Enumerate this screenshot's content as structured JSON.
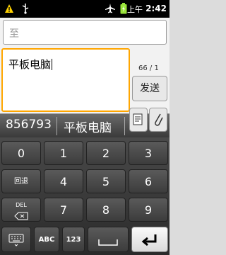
{
  "status_bar": {
    "ampm": "上午",
    "time": "2:42"
  },
  "compose": {
    "to_placeholder": "至",
    "message_text": "平板电脑",
    "counter": "66 / 1",
    "send_label": "发送"
  },
  "candidates": [
    "856793",
    "平板电脑"
  ],
  "keyboard": {
    "keys_row1": [
      "0",
      "1",
      "2",
      "3"
    ],
    "back_label": "回退",
    "keys_row2": [
      "4",
      "5",
      "6"
    ],
    "del_label": "DEL",
    "keys_row3": [
      "7",
      "8",
      "9"
    ],
    "abc_label": "ABC",
    "num_label": "123"
  }
}
